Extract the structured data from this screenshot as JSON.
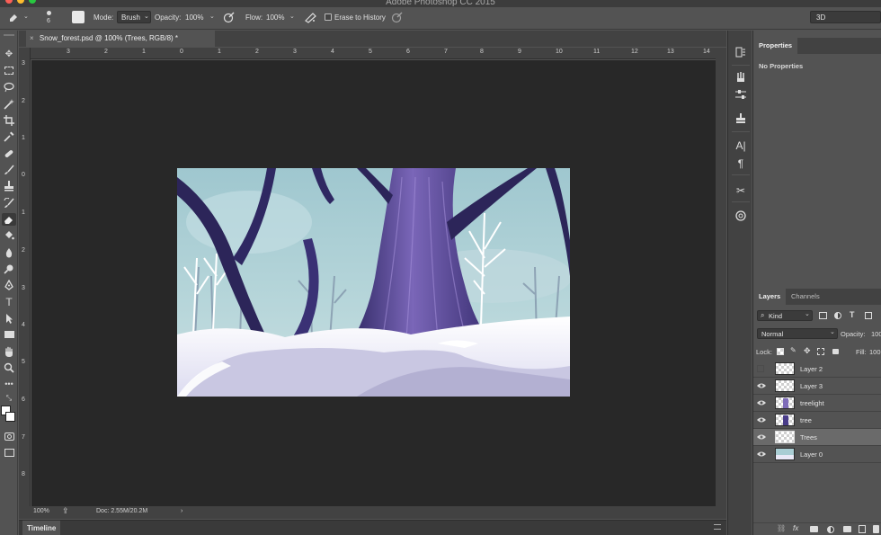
{
  "window": {
    "title": "Adobe Photoshop CC 2015",
    "workspace": "3D"
  },
  "options_bar": {
    "brush_size": "6",
    "mode_label": "Mode:",
    "mode_value": "Brush",
    "opacity_label": "Opacity:",
    "opacity_value": "100%",
    "flow_label": "Flow:",
    "flow_value": "100%",
    "erase_history_label": "Erase to History"
  },
  "document": {
    "tab_title": "Snow_forest.psd @ 100% (Trees, RGB/8) *",
    "zoom": "100%",
    "doc_size": "Doc: 2.55M/20.2M"
  },
  "rulers": {
    "horizontal": [
      "3",
      "2",
      "1",
      "0",
      "1",
      "2",
      "3",
      "4",
      "5",
      "6",
      "7",
      "8",
      "9",
      "10",
      "11",
      "12",
      "13",
      "14"
    ],
    "vertical": [
      "3",
      "2",
      "1",
      "0",
      "1",
      "2",
      "3",
      "4",
      "5",
      "6",
      "7",
      "8"
    ]
  },
  "timeline": {
    "label": "Timeline"
  },
  "properties": {
    "tab": "Properties",
    "empty_text": "No Properties"
  },
  "layers_panel": {
    "tabs": [
      "Layers",
      "Channels"
    ],
    "filter": "Kind",
    "blend_mode": "Normal",
    "opacity_label": "Opacity:",
    "opacity_value": "100",
    "lock_label": "Lock:",
    "fill_label": "Fill:",
    "fill_value": "100",
    "layers": [
      {
        "name": "Layer 2",
        "visible": false,
        "selected": false
      },
      {
        "name": "Layer 3",
        "visible": true,
        "selected": false
      },
      {
        "name": "treelight",
        "visible": true,
        "selected": false
      },
      {
        "name": "tree",
        "visible": true,
        "selected": false
      },
      {
        "name": "Trees",
        "visible": true,
        "selected": true
      },
      {
        "name": "Layer 0",
        "visible": true,
        "selected": false
      }
    ]
  },
  "colors": {
    "ui_dark": "#282828",
    "ui_mid": "#535353",
    "sky": "#a9cdd3",
    "trunk": "#5a4b94",
    "snow": "#f2f1fb"
  }
}
